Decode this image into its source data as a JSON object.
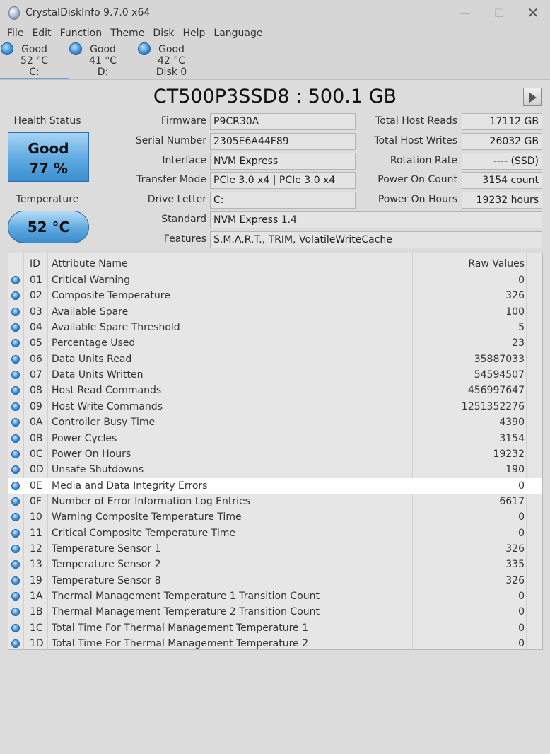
{
  "window": {
    "title": "CrystalDiskInfo 9.7.0 x64",
    "minimize_glyph": "—",
    "maximize_glyph": "☐",
    "close_glyph": "✕"
  },
  "menu": [
    "File",
    "Edit",
    "Function",
    "Theme",
    "Disk",
    "Help",
    "Language"
  ],
  "disks": [
    {
      "status": "Good",
      "temp": "52 °C",
      "name": "C:"
    },
    {
      "status": "Good",
      "temp": "41 °C",
      "name": "D:"
    },
    {
      "status": "Good",
      "temp": "42 °C",
      "name": "Disk 0"
    }
  ],
  "drive": {
    "title": "CT500P3SSD8 : 500.1 GB",
    "health_label": "Health Status",
    "health_status": "Good",
    "health_percent": "77 %",
    "temp_label": "Temperature",
    "temperature": "52 °C"
  },
  "fields_left": [
    {
      "label": "Firmware",
      "value": "P9CR30A"
    },
    {
      "label": "Serial Number",
      "value": "2305E6A44F89"
    },
    {
      "label": "Interface",
      "value": "NVM Express"
    },
    {
      "label": "Transfer Mode",
      "value": "PCIe 3.0 x4 | PCIe 3.0 x4"
    },
    {
      "label": "Drive Letter",
      "value": "C:"
    },
    {
      "label": "Standard",
      "value": "NVM Express 1.4"
    },
    {
      "label": "Features",
      "value": "S.M.A.R.T., TRIM, VolatileWriteCache"
    }
  ],
  "fields_right": [
    {
      "label": "Total Host Reads",
      "value": "17112 GB"
    },
    {
      "label": "Total Host Writes",
      "value": "26032 GB"
    },
    {
      "label": "Rotation Rate",
      "value": "---- (SSD)"
    },
    {
      "label": "Power On Count",
      "value": "3154 count"
    },
    {
      "label": "Power On Hours",
      "value": "19232 hours"
    }
  ],
  "table": {
    "headers": {
      "id": "ID",
      "name": "Attribute Name",
      "raw": "Raw Values"
    },
    "rows": [
      {
        "id": "01",
        "name": "Critical Warning",
        "raw": "0"
      },
      {
        "id": "02",
        "name": "Composite Temperature",
        "raw": "326"
      },
      {
        "id": "03",
        "name": "Available Spare",
        "raw": "100"
      },
      {
        "id": "04",
        "name": "Available Spare Threshold",
        "raw": "5"
      },
      {
        "id": "05",
        "name": "Percentage Used",
        "raw": "23"
      },
      {
        "id": "06",
        "name": "Data Units Read",
        "raw": "35887033"
      },
      {
        "id": "07",
        "name": "Data Units Written",
        "raw": "54594507"
      },
      {
        "id": "08",
        "name": "Host Read Commands",
        "raw": "456997647"
      },
      {
        "id": "09",
        "name": "Host Write Commands",
        "raw": "1251352276"
      },
      {
        "id": "0A",
        "name": "Controller Busy Time",
        "raw": "4390"
      },
      {
        "id": "0B",
        "name": "Power Cycles",
        "raw": "3154"
      },
      {
        "id": "0C",
        "name": "Power On Hours",
        "raw": "19232"
      },
      {
        "id": "0D",
        "name": "Unsafe Shutdowns",
        "raw": "190"
      },
      {
        "id": "0E",
        "name": "Media and Data Integrity Errors",
        "raw": "0",
        "highlighted": true
      },
      {
        "id": "0F",
        "name": "Number of Error Information Log Entries",
        "raw": "6617"
      },
      {
        "id": "10",
        "name": "Warning Composite Temperature Time",
        "raw": "0"
      },
      {
        "id": "11",
        "name": "Critical Composite Temperature Time",
        "raw": "0"
      },
      {
        "id": "12",
        "name": "Temperature Sensor 1",
        "raw": "326"
      },
      {
        "id": "13",
        "name": "Temperature Sensor 2",
        "raw": "335"
      },
      {
        "id": "19",
        "name": "Temperature Sensor 8",
        "raw": "326"
      },
      {
        "id": "1A",
        "name": "Thermal Management Temperature 1 Transition Count",
        "raw": "0"
      },
      {
        "id": "1B",
        "name": "Thermal Management Temperature 2 Transition Count",
        "raw": "0"
      },
      {
        "id": "1C",
        "name": "Total Time For Thermal Management Temperature 1",
        "raw": "0"
      },
      {
        "id": "1D",
        "name": "Total Time For Thermal Management Temperature 2",
        "raw": "0"
      }
    ]
  }
}
